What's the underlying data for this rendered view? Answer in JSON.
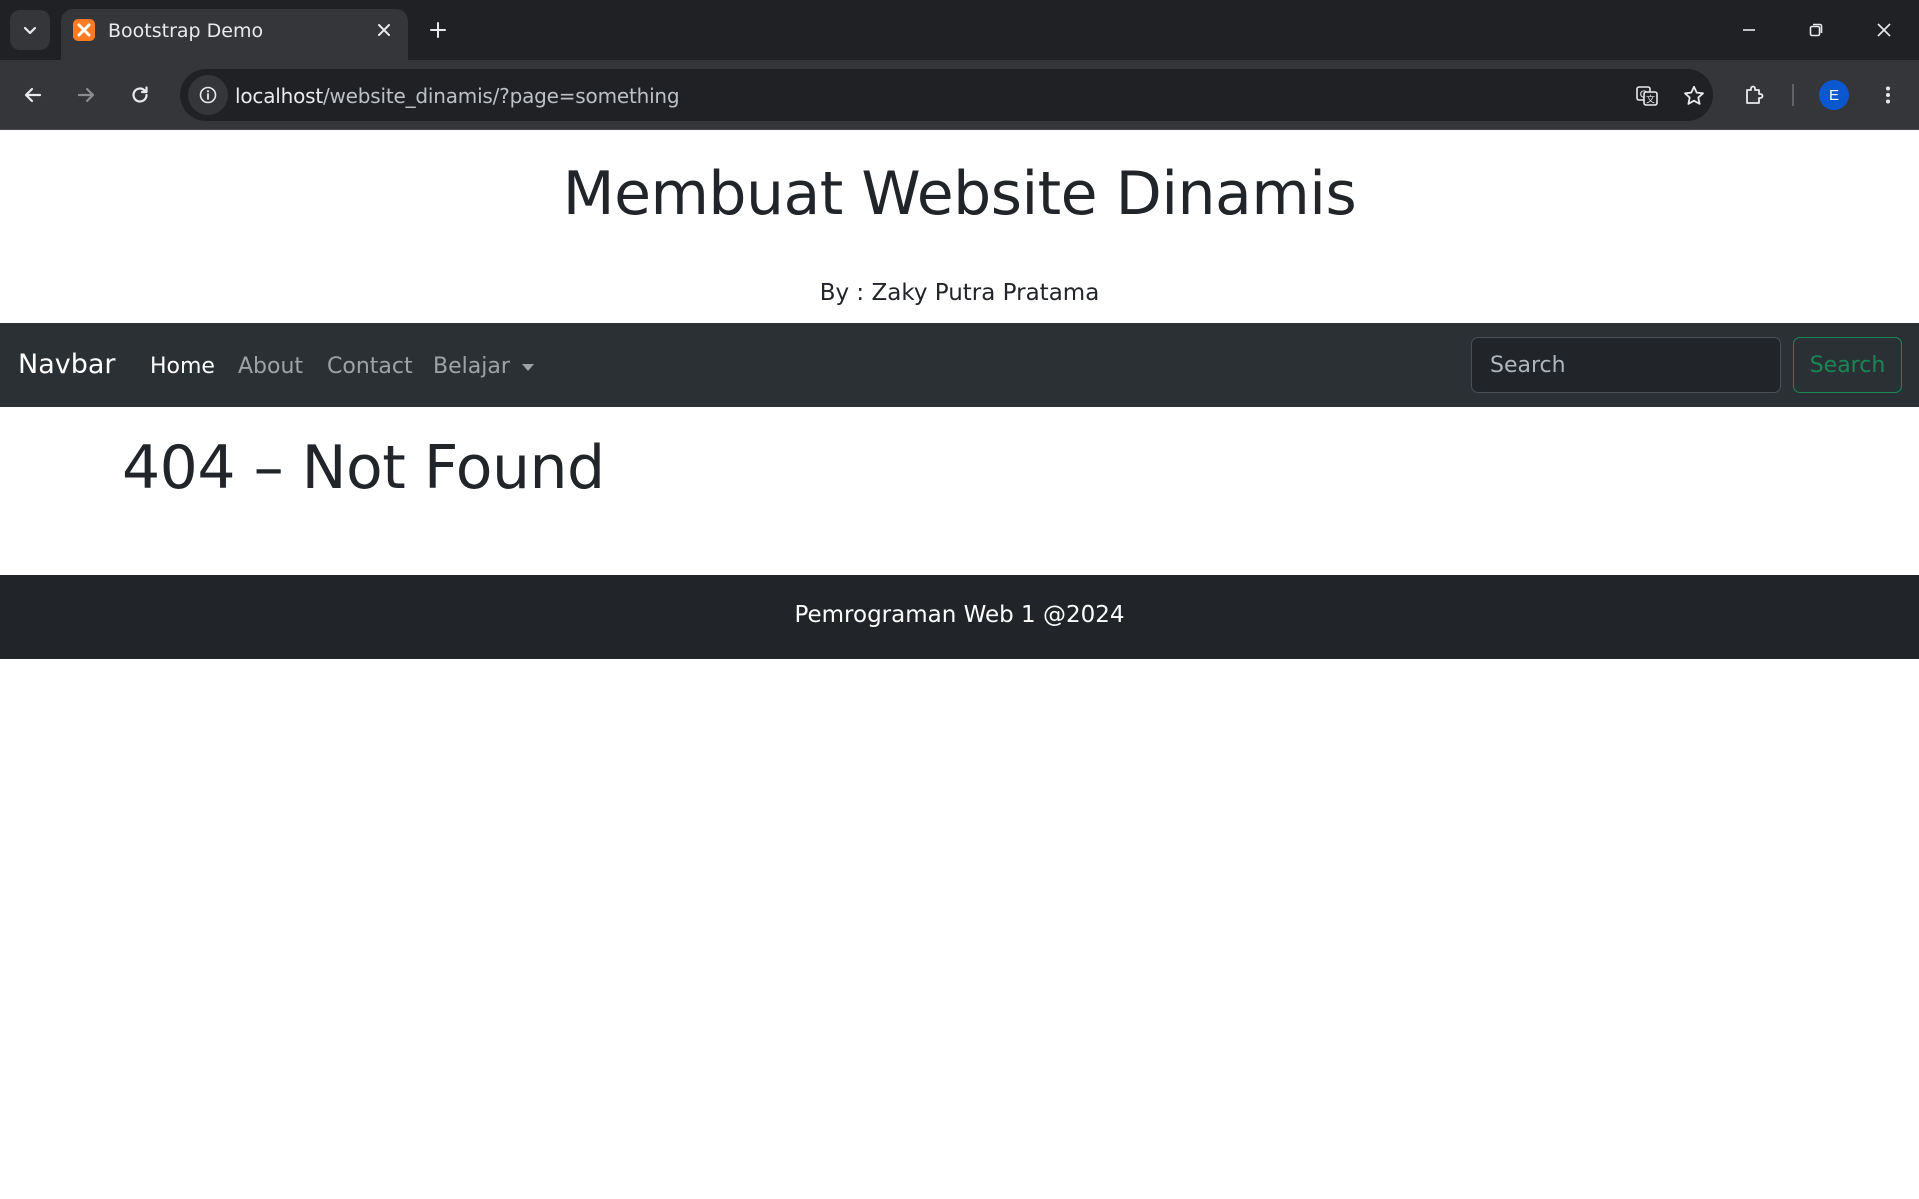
{
  "browser": {
    "tab": {
      "title": "Bootstrap Demo",
      "favicon": "xampp-icon"
    },
    "address": {
      "host": "localhost",
      "path": "/website_dinamis/?page=something"
    },
    "profile_initial": "E",
    "colors": {
      "favicon": "#fb7a24",
      "avatar": "#0b57d0"
    }
  },
  "site": {
    "title": "Membuat Website Dinamis",
    "author": "By : Zaky Putra Pratama"
  },
  "navbar": {
    "brand": "Navbar",
    "links": [
      {
        "label": "Home",
        "active": true
      },
      {
        "label": "About",
        "active": false
      },
      {
        "label": "Contact",
        "active": false
      },
      {
        "label": "Belajar",
        "active": false,
        "dropdown": true
      }
    ],
    "search_placeholder": "Search",
    "search_button": "Search",
    "colors": {
      "background": "#2b3035",
      "search_button": "#198754"
    }
  },
  "content": {
    "heading": "404 – Not Found"
  },
  "footer": {
    "text": "Pemrograman Web 1 @2024",
    "background": "#212529"
  }
}
